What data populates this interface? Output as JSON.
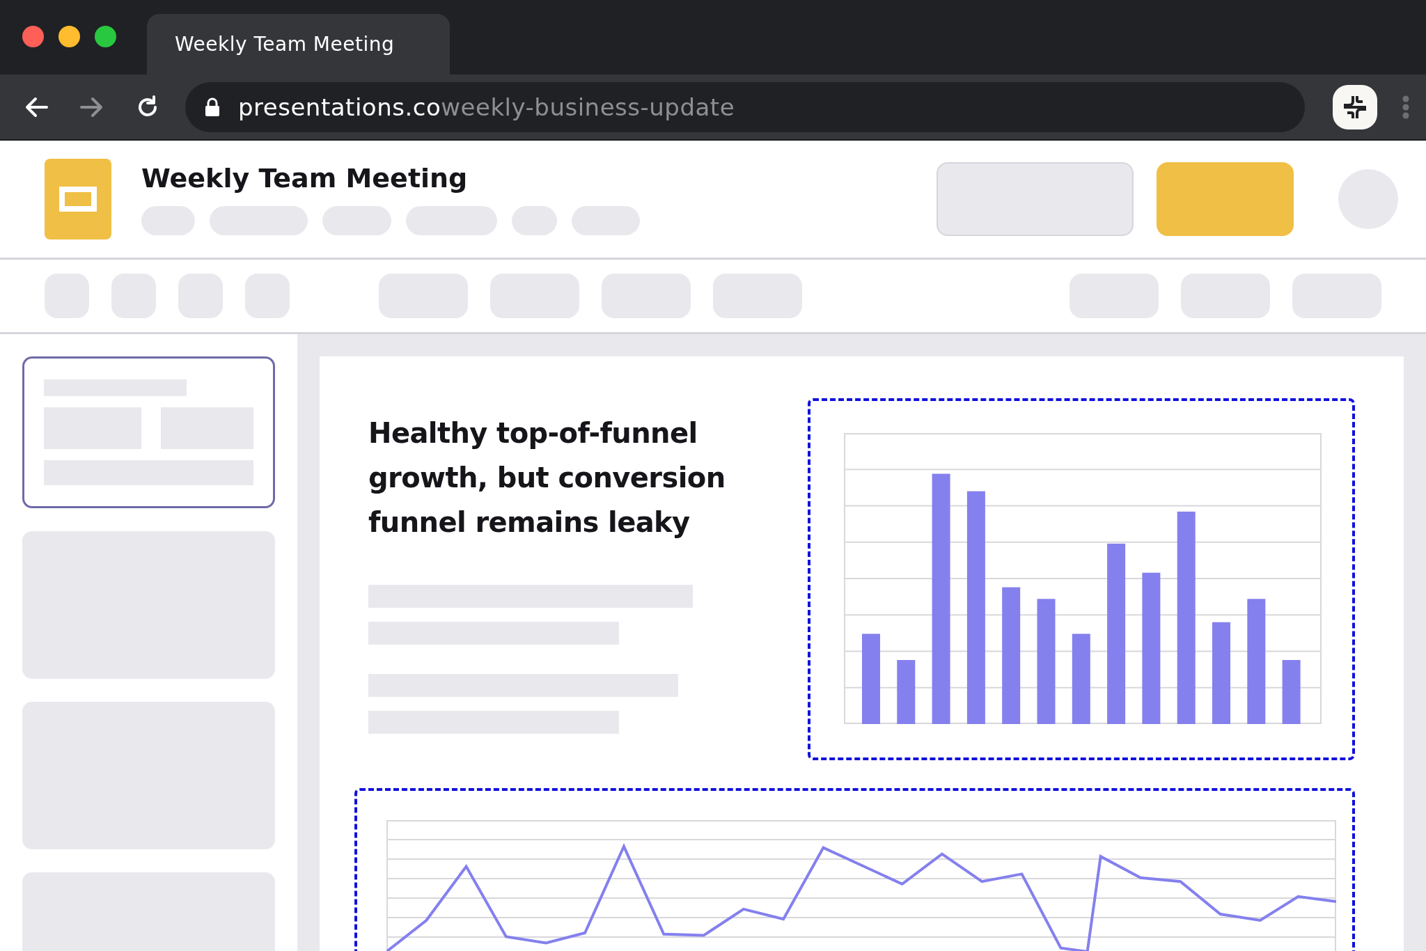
{
  "browser": {
    "tab_title": "Weekly Team Meeting",
    "url_host": "presentations.co",
    "url_path": "weekly-business-update"
  },
  "app": {
    "title": "Weekly Team Meeting"
  },
  "slide": {
    "heading": "Healthy top-of-funnel growth, but conversion funnel remains leaky"
  }
}
